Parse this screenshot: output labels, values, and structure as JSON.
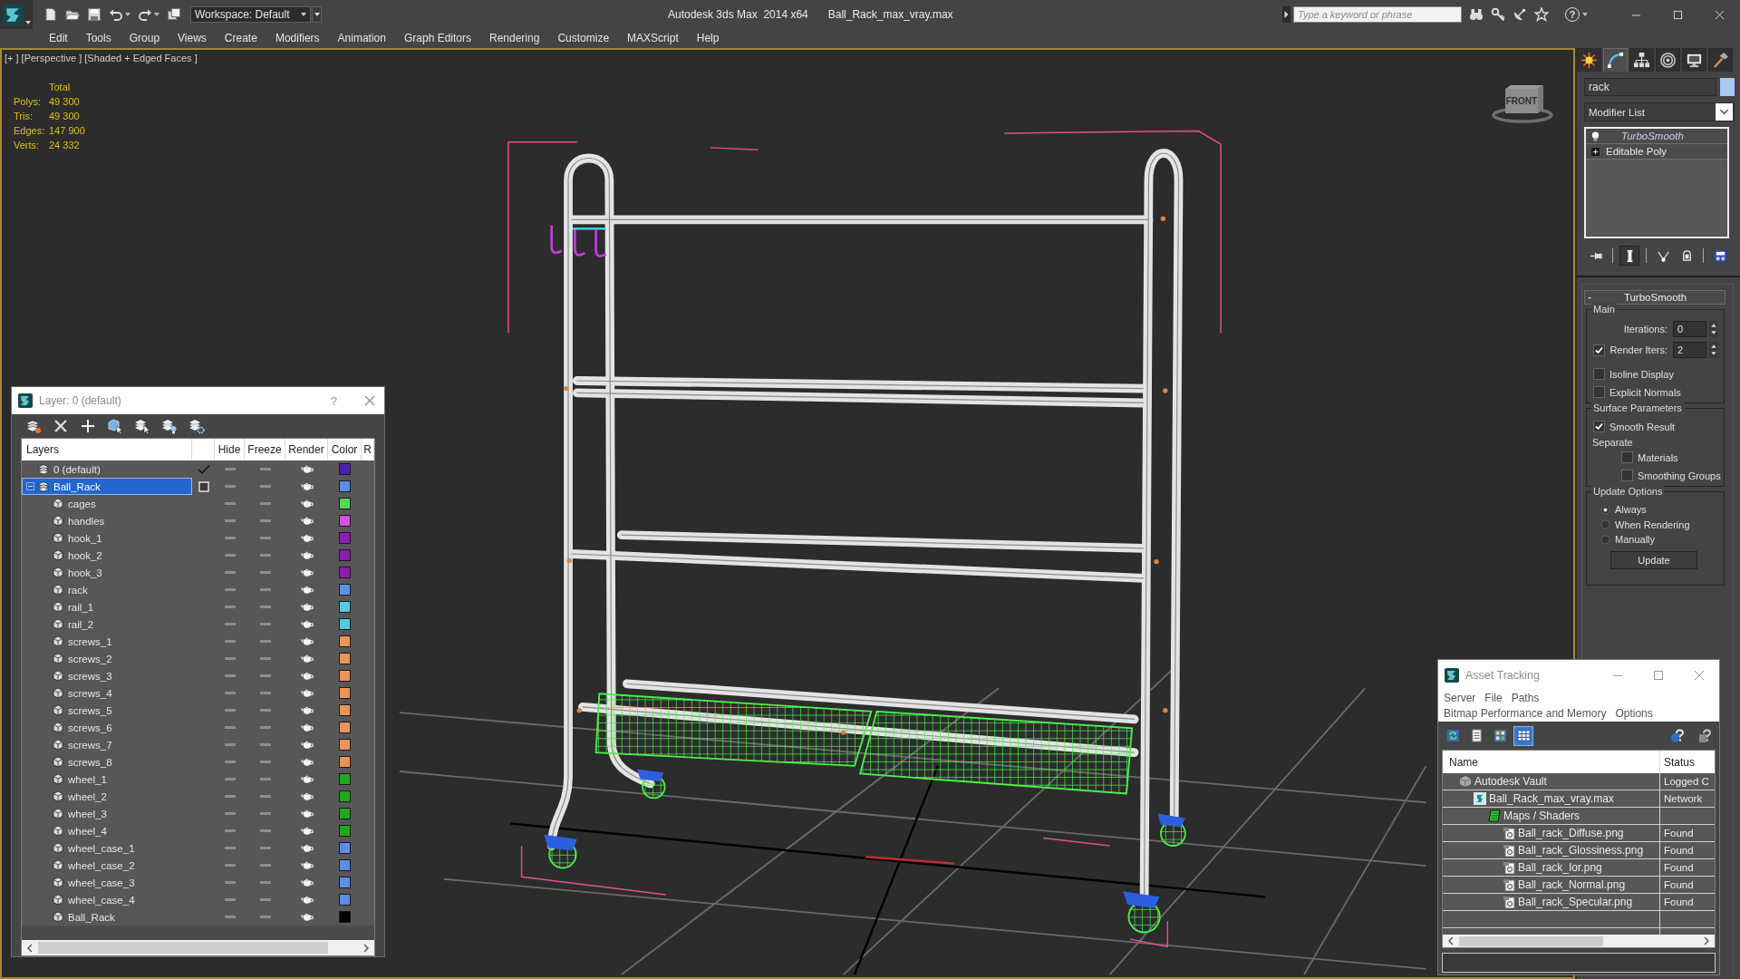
{
  "title_bar": {
    "workspace": "Workspace: Default",
    "app_title": "Autodesk 3ds Max  2014 x64",
    "file_name": "Ball_Rack_max_vray.max",
    "search": {
      "placeholder": "Type a keyword or phrase"
    },
    "help": "?"
  },
  "menu_bar": [
    "Edit",
    "Tools",
    "Group",
    "Views",
    "Create",
    "Modifiers",
    "Animation",
    "Graph Editors",
    "Rendering",
    "Customize",
    "MAXScript",
    "Help"
  ],
  "viewport": {
    "labels": [
      "[+ ]",
      "[Perspective ]",
      "[Shaded + Edged Faces ]"
    ],
    "stats": {
      "header": "Total",
      "rows": [
        {
          "label": "Polys:",
          "value": "49 300"
        },
        {
          "label": "Tris:",
          "value": "49 300"
        },
        {
          "label": "Edges:",
          "value": "147 900"
        },
        {
          "label": "Verts:",
          "value": "24 332"
        }
      ]
    },
    "viewcube": {
      "face": "FRONT"
    }
  },
  "layer_dialog": {
    "title": "Layer: 0 (default)",
    "help": "?",
    "columns": [
      "Layers",
      "Hide",
      "Freeze",
      "Render",
      "Color",
      "R"
    ],
    "layers": [
      {
        "name": "0 (default)",
        "kind": "layer",
        "current": true,
        "selected": false,
        "hidden": false,
        "frozen": false,
        "renderable": true,
        "color": "#4a1fb5"
      },
      {
        "name": "Ball_Rack",
        "kind": "layer",
        "current": false,
        "selected": true,
        "expanded": true,
        "hidden": false,
        "frozen": false,
        "renderable": true,
        "color": "#5b8fe3",
        "children": [
          {
            "name": "cages",
            "kind": "object",
            "selected": false,
            "hidden": false,
            "frozen": false,
            "renderable": true,
            "color": "#56d656"
          },
          {
            "name": "handles",
            "kind": "object",
            "selected": false,
            "hidden": false,
            "frozen": false,
            "renderable": true,
            "color": "#d055e0"
          },
          {
            "name": "hook_1",
            "kind": "object",
            "selected": false,
            "hidden": false,
            "frozen": false,
            "renderable": true,
            "color": "#8a1fb0"
          },
          {
            "name": "hook_2",
            "kind": "object",
            "selected": false,
            "hidden": false,
            "frozen": false,
            "renderable": true,
            "color": "#8a1fb0"
          },
          {
            "name": "hook_3",
            "kind": "object",
            "selected": false,
            "hidden": false,
            "frozen": false,
            "renderable": true,
            "color": "#8a1fb0"
          },
          {
            "name": "rack",
            "kind": "object",
            "selected": false,
            "hidden": false,
            "frozen": false,
            "renderable": true,
            "color": "#5b8fe3"
          },
          {
            "name": "rail_1",
            "kind": "object",
            "selected": false,
            "hidden": false,
            "frozen": false,
            "renderable": true,
            "color": "#56c8e3"
          },
          {
            "name": "rail_2",
            "kind": "object",
            "selected": false,
            "hidden": false,
            "frozen": false,
            "renderable": true,
            "color": "#56c8e3"
          },
          {
            "name": "screws_1",
            "kind": "object",
            "selected": false,
            "hidden": false,
            "frozen": false,
            "renderable": true,
            "color": "#e8955a"
          },
          {
            "name": "screws_2",
            "kind": "object",
            "selected": false,
            "hidden": false,
            "frozen": false,
            "renderable": true,
            "color": "#e8955a"
          },
          {
            "name": "screws_3",
            "kind": "object",
            "selected": false,
            "hidden": false,
            "frozen": false,
            "renderable": true,
            "color": "#e8955a"
          },
          {
            "name": "screws_4",
            "kind": "object",
            "selected": false,
            "hidden": false,
            "frozen": false,
            "renderable": true,
            "color": "#e8955a"
          },
          {
            "name": "screws_5",
            "kind": "object",
            "selected": false,
            "hidden": false,
            "frozen": false,
            "renderable": true,
            "color": "#e8955a"
          },
          {
            "name": "screws_6",
            "kind": "object",
            "selected": false,
            "hidden": false,
            "frozen": false,
            "renderable": true,
            "color": "#e8955a"
          },
          {
            "name": "screws_7",
            "kind": "object",
            "selected": false,
            "hidden": false,
            "frozen": false,
            "renderable": true,
            "color": "#e8955a"
          },
          {
            "name": "screws_8",
            "kind": "object",
            "selected": false,
            "hidden": false,
            "frozen": false,
            "renderable": true,
            "color": "#e8955a"
          },
          {
            "name": "wheel_1",
            "kind": "object",
            "selected": false,
            "hidden": false,
            "frozen": false,
            "renderable": true,
            "color": "#1fa81f"
          },
          {
            "name": "wheel_2",
            "kind": "object",
            "selected": false,
            "hidden": false,
            "frozen": false,
            "renderable": true,
            "color": "#1fa81f"
          },
          {
            "name": "wheel_3",
            "kind": "object",
            "selected": false,
            "hidden": false,
            "frozen": false,
            "renderable": true,
            "color": "#1fa81f"
          },
          {
            "name": "wheel_4",
            "kind": "object",
            "selected": false,
            "hidden": false,
            "frozen": false,
            "renderable": true,
            "color": "#1fa81f"
          },
          {
            "name": "wheel_case_1",
            "kind": "object",
            "selected": false,
            "hidden": false,
            "frozen": false,
            "renderable": true,
            "color": "#5b8fe3"
          },
          {
            "name": "wheel_case_2",
            "kind": "object",
            "selected": false,
            "hidden": false,
            "frozen": false,
            "renderable": true,
            "color": "#5b8fe3"
          },
          {
            "name": "wheel_case_3",
            "kind": "object",
            "selected": false,
            "hidden": false,
            "frozen": false,
            "renderable": true,
            "color": "#5b8fe3"
          },
          {
            "name": "wheel_case_4",
            "kind": "object",
            "selected": false,
            "hidden": false,
            "frozen": false,
            "renderable": true,
            "color": "#5b8fe3"
          },
          {
            "name": "Ball_Rack",
            "kind": "object",
            "selected": false,
            "hidden": false,
            "frozen": false,
            "renderable": true,
            "color": "#000000"
          }
        ]
      }
    ]
  },
  "command_panel": {
    "tabs": [
      {
        "kind": "create",
        "selected": false
      },
      {
        "kind": "modify",
        "selected": true
      },
      {
        "kind": "hierarchy",
        "selected": false
      },
      {
        "kind": "motion",
        "selected": false
      },
      {
        "kind": "display",
        "selected": false
      },
      {
        "kind": "utilities",
        "selected": false
      }
    ],
    "object_name": "rack",
    "modifier_list": "Modifier List",
    "stack": [
      {
        "name": "TurboSmooth",
        "kind": "modifier",
        "enabled": true
      },
      {
        "name": "Editable Poly",
        "kind": "object",
        "expanded": false
      }
    ],
    "stack_tools": [
      {
        "kind": "pin",
        "pressed": false
      },
      {
        "kind": "end-result",
        "pressed": true
      },
      {
        "kind": "unique",
        "pressed": false
      },
      {
        "kind": "remove",
        "pressed": false
      },
      {
        "kind": "sets",
        "pressed": false
      }
    ],
    "rollout": {
      "toggle": "-",
      "title": "TurboSmooth",
      "groups": [
        {
          "legend": "Main",
          "items": [
            {
              "kind": "spinner",
              "label": "Iterations:",
              "value": "0"
            },
            {
              "kind": "check-spinner",
              "label": "Render Iters:",
              "value": "2",
              "checked": true
            },
            {
              "kind": "checkbox",
              "label": "Isoline Display",
              "checked": false
            },
            {
              "kind": "checkbox",
              "label": "Explicit Normals",
              "checked": false
            }
          ]
        },
        {
          "legend": "Surface Parameters",
          "items": [
            {
              "kind": "checkbox",
              "label": "Smooth Result",
              "checked": true
            },
            {
              "kind": "subhead",
              "label": "Separate"
            },
            {
              "kind": "sub-checkbox",
              "label": "Materials",
              "checked": false
            },
            {
              "kind": "sub-checkbox",
              "label": "Smoothing Groups",
              "checked": false
            }
          ]
        },
        {
          "legend": "Update Options",
          "items": [
            {
              "kind": "radio",
              "label": "Always",
              "selected": true
            },
            {
              "kind": "radio",
              "label": "When Rendering",
              "selected": false
            },
            {
              "kind": "radio",
              "label": "Manually",
              "selected": false
            },
            {
              "kind": "button",
              "label": "Update"
            }
          ]
        }
      ]
    }
  },
  "asset_tracking": {
    "title": "Asset Tracking",
    "menus": [
      [
        "Server",
        "File",
        "Paths"
      ],
      [
        "Bitmap Performance and Memory",
        "Options"
      ]
    ],
    "toolbar": [
      {
        "kind": "refresh",
        "selected": false
      },
      {
        "kind": "list",
        "selected": false
      },
      {
        "kind": "thumbnails",
        "selected": false
      },
      {
        "kind": "table",
        "selected": true
      }
    ],
    "columns": [
      "Name",
      "Status"
    ],
    "tree": [
      {
        "name": "Autodesk Vault",
        "status": "Logged C",
        "kind": "vault",
        "selected": false,
        "children": [
          {
            "name": "Ball_Rack_max_vray.max",
            "status": "Network",
            "kind": "scene",
            "selected": false,
            "children": [
              {
                "name": "Maps / Shaders",
                "kind": "folder",
                "selected": false,
                "children": [
                  {
                    "name": "Ball_rack_Diffuse.png",
                    "status": "Found",
                    "kind": "bitmap",
                    "selected": false
                  },
                  {
                    "name": "Ball_rack_Glossiness.png",
                    "status": "Found",
                    "kind": "bitmap",
                    "selected": false
                  },
                  {
                    "name": "Ball_rack_Ior.png",
                    "status": "Found",
                    "kind": "bitmap",
                    "selected": false
                  },
                  {
                    "name": "Ball_rack_Normal.png",
                    "status": "Found",
                    "kind": "bitmap",
                    "selected": false
                  },
                  {
                    "name": "Ball_rack_Specular.png",
                    "status": "Found",
                    "kind": "bitmap",
                    "selected": false
                  }
                ]
              }
            ]
          }
        ]
      }
    ]
  }
}
